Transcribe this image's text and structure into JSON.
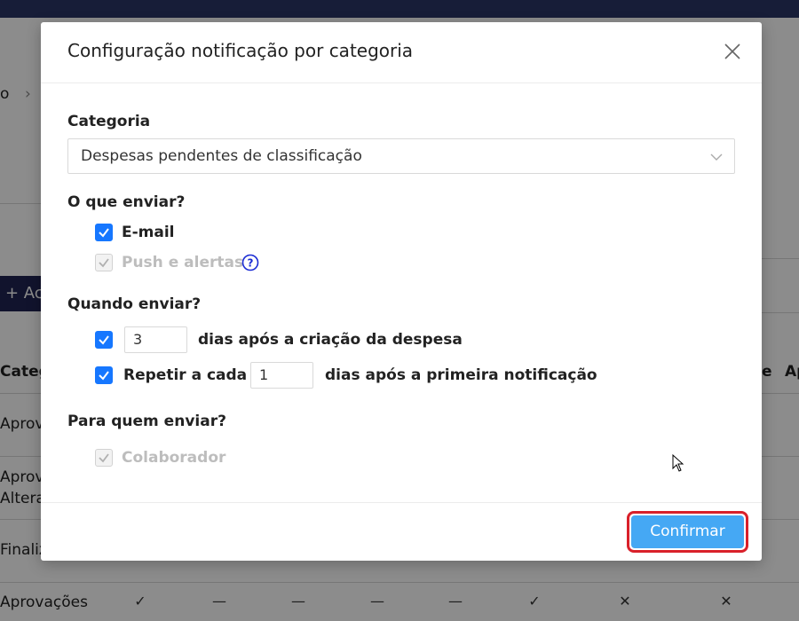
{
  "background": {
    "breadcrumb_fragment": "o",
    "add_button_label": "+ Ac",
    "table_header_first": "Categ",
    "table_header_right_1": "e",
    "table_header_right_2": "Ap",
    "rows": [
      "Aprov",
      "Aprov",
      "Altera",
      "Finaliz",
      "Aprovações"
    ],
    "last_row_marks": [
      "✓",
      "—",
      "—",
      "—",
      "—",
      "✓",
      "✕",
      "✕"
    ]
  },
  "modal": {
    "title": "Configuração notificação por categoria",
    "close_icon": "close-icon",
    "category": {
      "label": "Categoria",
      "selected": "Despesas pendentes de classificação"
    },
    "what": {
      "label": "O que enviar?",
      "email": {
        "label": "E-mail",
        "checked": true,
        "disabled": false
      },
      "push": {
        "label": "Push e alertas",
        "checked": true,
        "disabled": true
      }
    },
    "when": {
      "label": "Quando enviar?",
      "after_creation": {
        "value": "3",
        "label": "dias após a criação da despesa",
        "checked": true
      },
      "repeat": {
        "prefix": "Repetir a cada",
        "value": "1",
        "label": "dias após a primeira notificação",
        "checked": true
      }
    },
    "who": {
      "label": "Para quem enviar?",
      "collaborator": {
        "label": "Colaborador",
        "checked": true,
        "disabled": true
      }
    },
    "confirm_label": "Confirmar"
  },
  "colors": {
    "primary": "#1677ff",
    "confirm": "#45a8f4",
    "highlight": "#d9202a",
    "disabled_text": "#bdbdbd"
  }
}
